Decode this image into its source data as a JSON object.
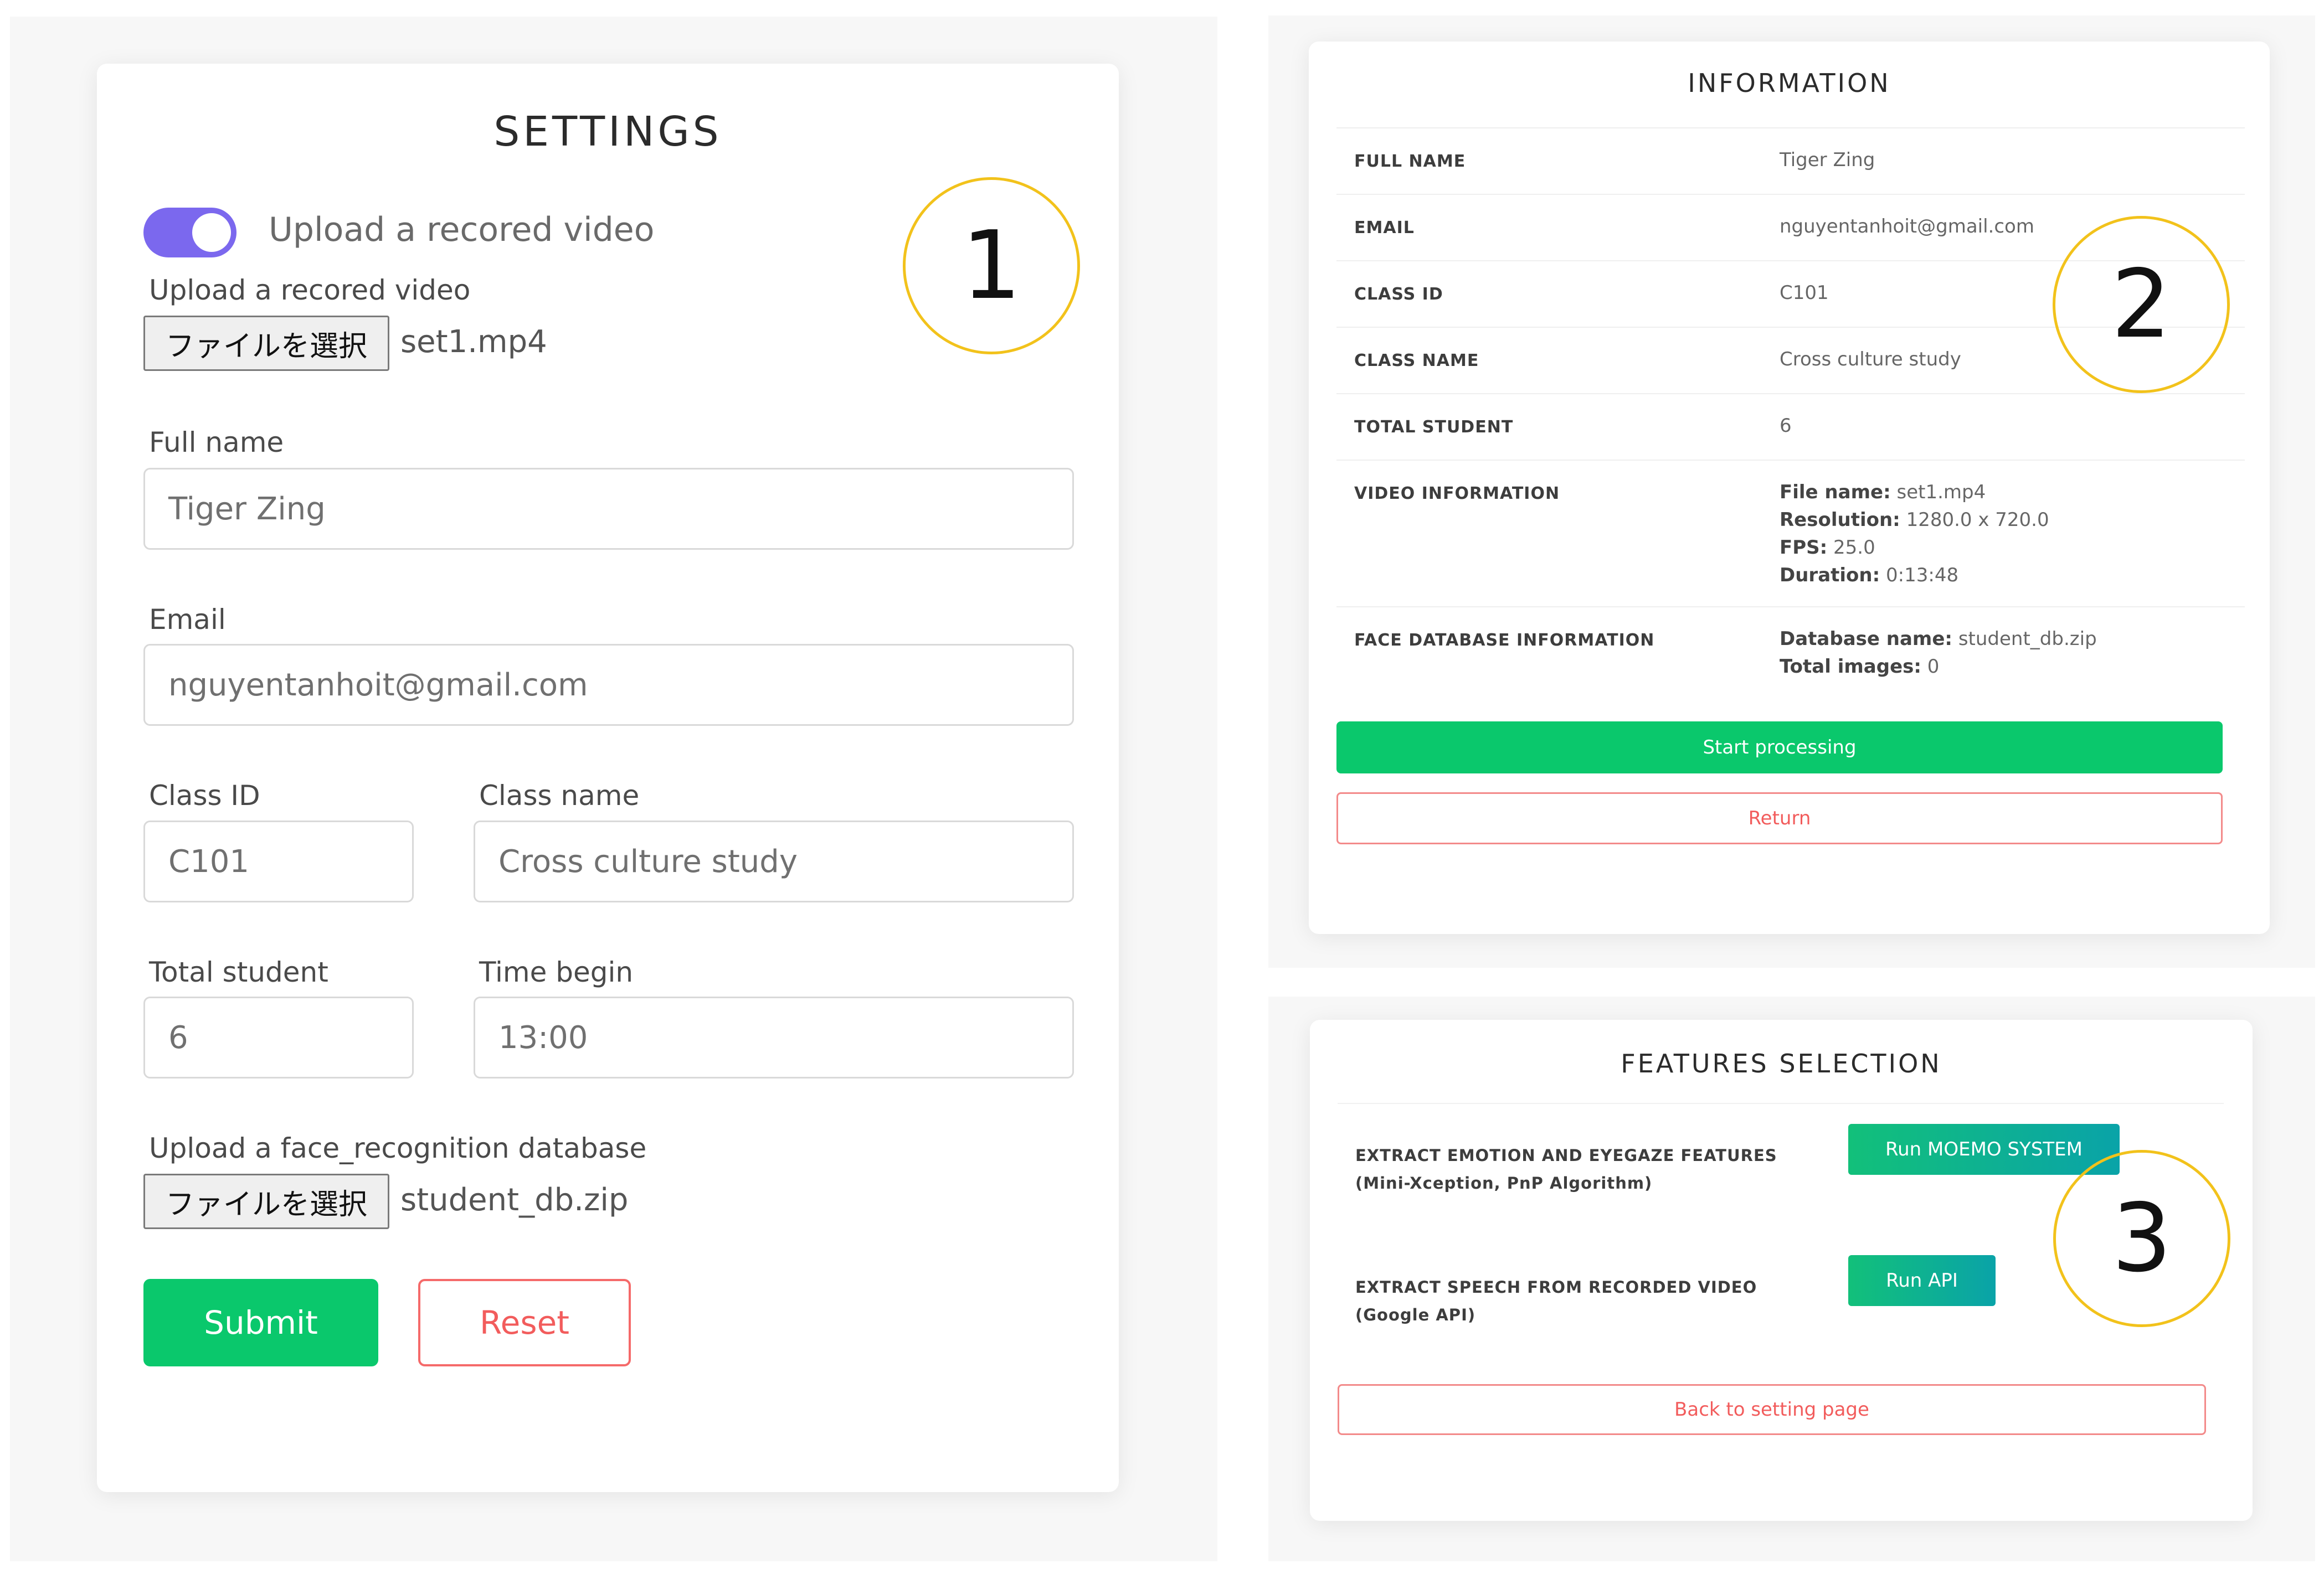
{
  "settings": {
    "title": "SETTINGS",
    "toggle_label": "Upload a recored video",
    "video_label": "Upload a recored video",
    "file_button": "ファイルを選択",
    "video_file": "set1.mp4",
    "full_name_label": "Full name",
    "full_name_value": "Tiger Zing",
    "email_label": "Email",
    "email_value": "nguyentanhoit@gmail.com",
    "class_id_label": "Class ID",
    "class_id_value": "C101",
    "class_name_label": "Class name",
    "class_name_value": "Cross culture study",
    "total_student_label": "Total student",
    "total_student_value": "6",
    "time_begin_label": "Time begin",
    "time_begin_value": "13:00",
    "db_label": "Upload a face_recognition database",
    "db_file": "student_db.zip",
    "submit_label": "Submit",
    "reset_label": "Reset"
  },
  "information": {
    "title": "INFORMATION",
    "full_name_label": "FULL NAME",
    "full_name_value": "Tiger Zing",
    "email_label": "EMAIL",
    "email_value": "nguyentanhoit@gmail.com",
    "class_id_label": "CLASS ID",
    "class_id_value": "C101",
    "class_name_label": "CLASS NAME",
    "class_name_value": "Cross culture study",
    "total_student_label": "TOTAL STUDENT",
    "total_student_value": "6",
    "video_info_label": "VIDEO INFORMATION",
    "video": {
      "file_name_key": "File name:",
      "file_name": "set1.mp4",
      "resolution_key": "Resolution:",
      "resolution": "1280.0 x 720.0",
      "fps_key": "FPS:",
      "fps": "25.0",
      "duration_key": "Duration:",
      "duration": "0:13:48"
    },
    "face_db_label": "FACE DATABASE INFORMATION",
    "face_db": {
      "db_name_key": "Database name:",
      "db_name": "student_db.zip",
      "total_images_key": "Total images:",
      "total_images": "0"
    },
    "start_label": "Start processing",
    "return_label": "Return"
  },
  "features": {
    "title": "FEATURES SELECTION",
    "emotion_line1": "EXTRACT EMOTION AND EYEGAZE FEATURES",
    "emotion_line2": "(Mini-Xception, PnP Algorithm)",
    "run_moemo_label": "Run MOEMO SYSTEM",
    "speech_line1": "EXTRACT SPEECH FROM RECORDED VIDEO",
    "speech_line2": "(Google API)",
    "run_api_label": "Run API",
    "back_label": "Back to setting page"
  },
  "markers": {
    "one": "1",
    "two": "2",
    "three": "3"
  },
  "colors": {
    "primary_green": "#0ac86c",
    "toggle_purple": "#7b68ee",
    "danger_red": "#f25c5c",
    "marker_yellow": "#f2c21b"
  }
}
